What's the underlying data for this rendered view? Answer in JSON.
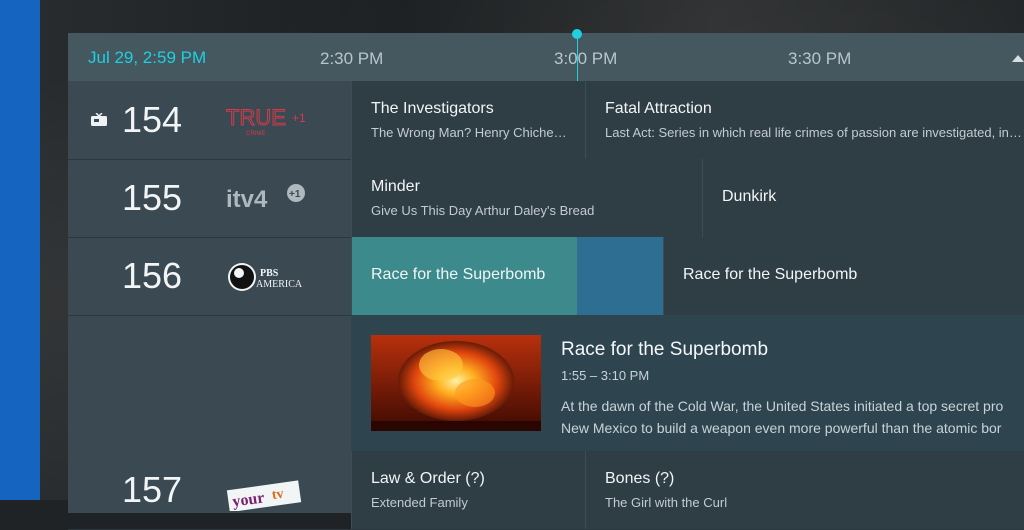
{
  "header": {
    "current_datetime": "Jul 29, 2:59 PM",
    "slots": [
      "2:30 PM",
      "3:00 PM",
      "3:30 PM"
    ]
  },
  "channels": [
    {
      "number": "154",
      "logo": "TRUE +1 CRIME",
      "programs": [
        {
          "title": "The Investigators",
          "subtitle": "The Wrong Man? Henry Chiche…"
        },
        {
          "title": "Fatal Attraction",
          "subtitle": "Last Act: Series in which real life crimes of passion are investigated, in…"
        }
      ]
    },
    {
      "number": "155",
      "logo": "itv4 +1",
      "programs": [
        {
          "title": "Minder",
          "subtitle": "Give Us This Day Arthur Daley's Bread"
        },
        {
          "title": "Dunkirk",
          "subtitle": ""
        }
      ]
    },
    {
      "number": "156",
      "logo": "PBS AMERICA",
      "programs": [
        {
          "title": "Race for the Superbomb",
          "subtitle": ""
        },
        {
          "title": "Race for the Superbomb",
          "subtitle": ""
        }
      ]
    },
    {
      "number": "157",
      "logo": "yourtv",
      "programs": [
        {
          "title": "Law & Order (?)",
          "subtitle": "Extended Family"
        },
        {
          "title": "Bones (?)",
          "subtitle": "The Girl with the Curl"
        }
      ]
    }
  ],
  "detail": {
    "title": "Race for the Superbomb",
    "time": "1:55 – 3:10 PM",
    "description_line1": "At the dawn of the Cold War, the United States initiated a top secret pro",
    "description_line2": "New Mexico to build a weapon even more powerful than the atomic bor"
  },
  "icons": {
    "tv": "tv-icon",
    "scroll_up": "chevron-up-icon"
  },
  "colors": {
    "accent": "#1fd0e0",
    "selected_program": "#3c8a8c",
    "side_bar": "#1565c0"
  }
}
